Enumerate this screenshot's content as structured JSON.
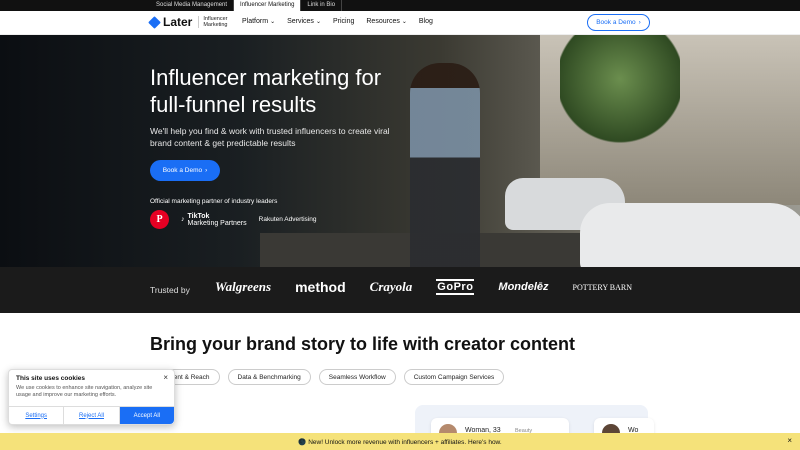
{
  "topbar": {
    "tabs": [
      {
        "label": "Social Media Management",
        "active": false
      },
      {
        "label": "Influencer Marketing",
        "active": true
      },
      {
        "label": "Link in Bio",
        "active": false
      }
    ]
  },
  "nav": {
    "logo_text": "Later",
    "logo_sub": "Influencer Marketing",
    "items": [
      {
        "label": "Platform",
        "dropdown": true
      },
      {
        "label": "Services",
        "dropdown": true
      },
      {
        "label": "Pricing",
        "dropdown": false
      },
      {
        "label": "Resources",
        "dropdown": true
      },
      {
        "label": "Blog",
        "dropdown": false
      }
    ],
    "cta_label": "Book a Demo",
    "accent_color": "#1a6ef5"
  },
  "hero": {
    "title": "Influencer marketing for full-funnel results",
    "subtitle": "We'll help you find & work with trusted influencers to create viral brand content & get predictable results",
    "cta_label": "Book a Demo",
    "partner_label": "Official marketing partner of industry leaders",
    "partners": {
      "pinterest": "P",
      "tiktok_title": "TikTok",
      "tiktok_sub": "Marketing Partners",
      "rakuten": "Rakuten Advertising"
    }
  },
  "trusted": {
    "label": "Trusted by",
    "brands": [
      "Walgreens",
      "method",
      "Crayola",
      "GoPro",
      "Mondelēz",
      "POTTERY BARN"
    ]
  },
  "section": {
    "title": "Bring your brand story to life with creator content",
    "pills": [
      "Content & Reach",
      "Data & Benchmarking",
      "Seamless Workflow",
      "Custom Campaign Services"
    ]
  },
  "preview": {
    "card1_name": "Woman, 33",
    "card1_tag": "Beauty",
    "card2_name": "Wo"
  },
  "cookie": {
    "title": "This site uses cookies",
    "body": "We use cookies to enhance site navigation, analyze site usage and improve our marketing efforts.",
    "settings_label": "Settings",
    "reject_label": "Reject All",
    "accept_label": "Accept All"
  },
  "banner": {
    "text": "🌑 New! Unlock more revenue with influencers + affiliates. Here's how."
  }
}
